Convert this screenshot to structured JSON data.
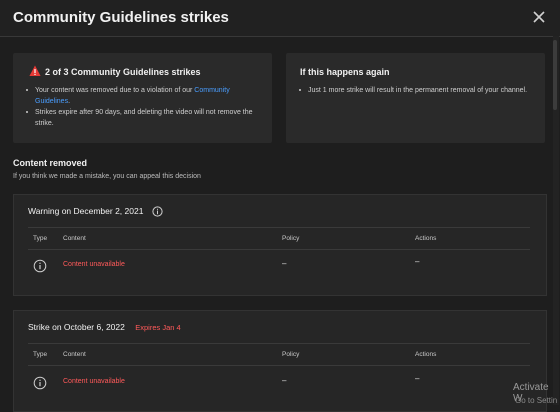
{
  "header": {
    "title": "Community Guidelines strikes"
  },
  "summary": {
    "title": "2 of 3 Community Guidelines strikes",
    "bullet1_prefix": "Your content was removed due to a violation of our ",
    "bullet1_link": "Community Guidelines",
    "bullet1_suffix": ".",
    "bullet2": "Strikes expire after 90 days, and deleting the video will not remove the strike."
  },
  "again": {
    "title": "If this happens again",
    "bullet1": "Just 1 more strike will result in the permanent removal of your channel."
  },
  "removed": {
    "title": "Content removed",
    "subtitle": "If you think we made a mistake, you can appeal this decision"
  },
  "columns": {
    "type": "Type",
    "content": "Content",
    "policy": "Policy",
    "actions": "Actions"
  },
  "strikes": [
    {
      "heading": "Warning on December 2, 2021",
      "expires": "",
      "content": "Content unavailable",
      "policy": "–",
      "actions": "–"
    },
    {
      "heading": "Strike on October 6, 2022",
      "expires": "Expires Jan 4",
      "content": "Content unavailable",
      "policy": "–",
      "actions": "–"
    }
  ],
  "watermark": {
    "line1": "Activate W",
    "line2": "Go to Settin"
  },
  "colors": {
    "accent_link": "#4a9eff",
    "alert_red": "#ff5a5a",
    "warning_icon": "#e53935"
  }
}
